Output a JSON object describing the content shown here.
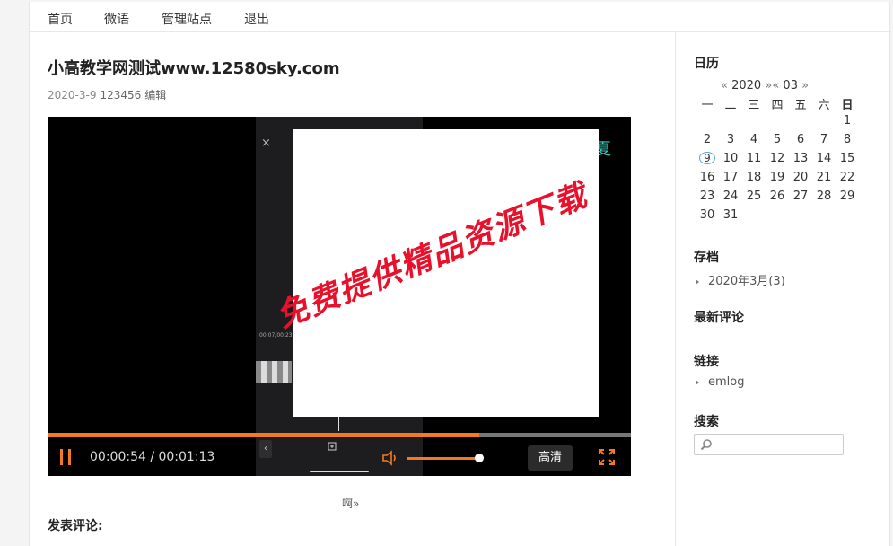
{
  "nav": {
    "items": [
      "首页",
      "微语",
      "管理站点",
      "退出"
    ]
  },
  "post": {
    "title": "小高教学网测试www.12580sky.com",
    "date": "2020-3-9",
    "author": "123456",
    "edit": "编辑",
    "read_more": "啊»",
    "comment_title": "发表评论:"
  },
  "video": {
    "watermark": "免费提供精品资源下载",
    "corner_glyph": "夏",
    "phone_time": "00:07/00:23",
    "phone_close": "×",
    "phone_back": "‹",
    "timecode": "00:00:54 / 00:01:13",
    "progress": 0.74,
    "volume": 0.95,
    "quality_label": "高清",
    "accent_color": "#f47920"
  },
  "sidebar": {
    "calendar_title": "日历",
    "calendar_nav": {
      "prev_year": "«",
      "year": "2020",
      "next_year": "»",
      "prev_month": "«",
      "month": "03",
      "next_month": "»"
    },
    "weekdays": [
      "一",
      "二",
      "三",
      "四",
      "五",
      "六",
      "日"
    ],
    "weeks": [
      [
        "",
        "",
        "",
        "",
        "",
        "",
        "1"
      ],
      [
        "2",
        "3",
        "4",
        "5",
        "6",
        "7",
        "8"
      ],
      [
        "9",
        "10",
        "11",
        "12",
        "13",
        "14",
        "15"
      ],
      [
        "16",
        "17",
        "18",
        "19",
        "20",
        "21",
        "22"
      ],
      [
        "23",
        "24",
        "25",
        "26",
        "27",
        "28",
        "29"
      ],
      [
        "30",
        "31",
        "",
        "",
        "",
        "",
        ""
      ]
    ],
    "today": "9",
    "archive_title": "存档",
    "archive_items": [
      "2020年3月(3)"
    ],
    "recent_comments_title": "最新评论",
    "links_title": "链接",
    "link_items": [
      "emlog"
    ],
    "search_title": "搜索",
    "search_placeholder": ""
  }
}
